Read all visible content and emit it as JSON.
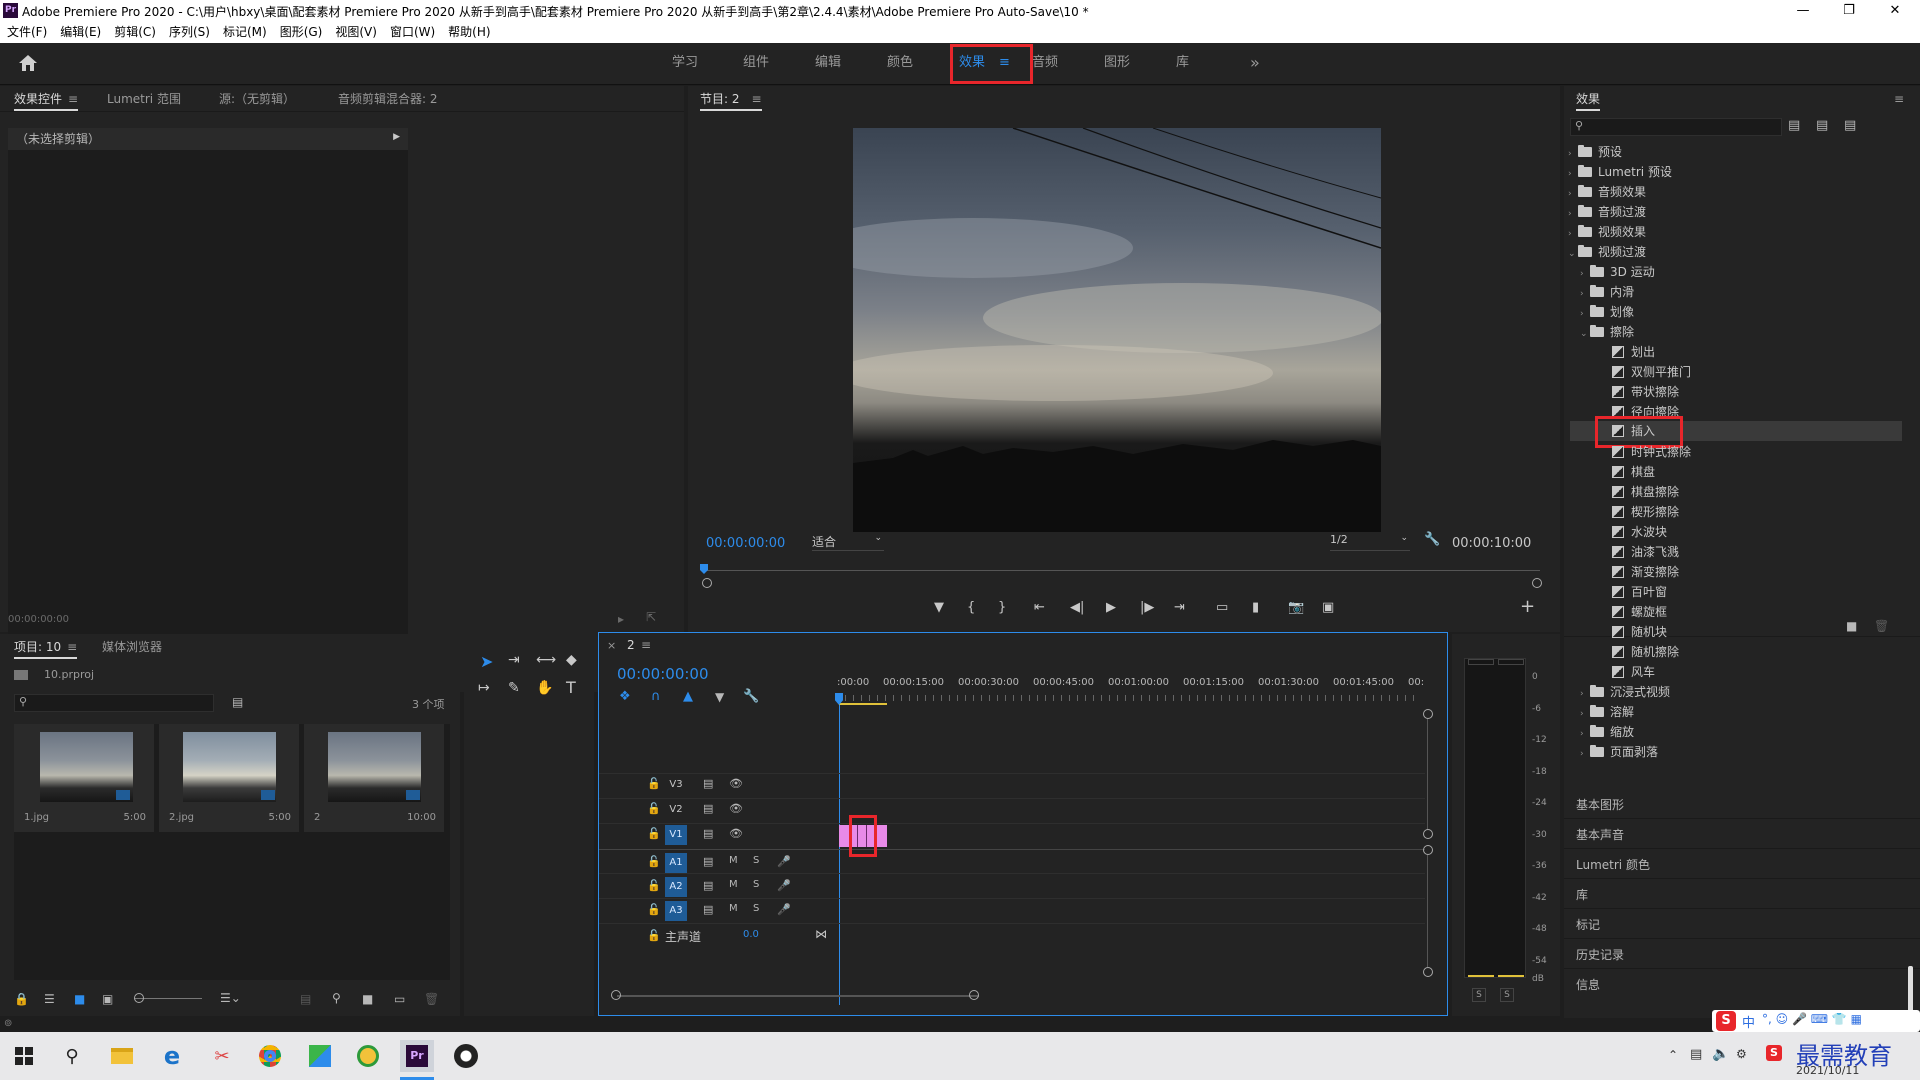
{
  "window": {
    "title": "Adobe Premiere Pro 2020 - C:\\用户\\hbxy\\桌面\\配套素材 Premiere Pro 2020 从新手到高手\\配套素材 Premiere Pro 2020 从新手到高手\\第2章\\2.4.4\\素材\\Adobe Premiere Pro Auto-Save\\10 *",
    "app_icon": "Pr"
  },
  "menu": [
    "文件(F)",
    "编辑(E)",
    "剪辑(C)",
    "序列(S)",
    "标记(M)",
    "图形(G)",
    "视图(V)",
    "窗口(W)",
    "帮助(H)"
  ],
  "workspaces": {
    "tabs": [
      "学习",
      "组件",
      "编辑",
      "颜色",
      "效果",
      "音频",
      "图形",
      "库"
    ],
    "active": "效果",
    "more": "»"
  },
  "effect_controls": {
    "tabs": [
      "效果控件",
      "Lumetri 范围",
      "源:（无剪辑）",
      "音频剪辑混合器: 2"
    ],
    "no_clip": "（未选择剪辑）",
    "timecode": "00:00:00:00"
  },
  "program_monitor": {
    "title": "节目: 2",
    "timecode_current": "00:00:00:00",
    "fit": "适合",
    "quality": "1/2",
    "timecode_duration": "00:00:10:00"
  },
  "project": {
    "tabs": [
      "项目: 10",
      "媒体浏览器"
    ],
    "file": "10.prproj",
    "item_count": "3 个项",
    "items": [
      {
        "name": "1.jpg",
        "duration": "5:00"
      },
      {
        "name": "2.jpg",
        "duration": "5:00"
      },
      {
        "name": "2",
        "duration": "10:00"
      }
    ]
  },
  "timeline": {
    "tab": "2",
    "timecode": "00:00:00:00",
    "ruler": [
      ":00:00",
      "00:00:15:00",
      "00:00:30:00",
      "00:00:45:00",
      "00:01:00:00",
      "00:01:15:00",
      "00:01:30:00",
      "00:01:45:00",
      "00:"
    ],
    "video_tracks": [
      "V3",
      "V2",
      "V1"
    ],
    "audio_tracks": [
      "A1",
      "A2",
      "A3"
    ],
    "master": "主声道",
    "master_value": "0.0",
    "m_label": "M",
    "s_label": "S"
  },
  "meter": {
    "scale": [
      "0",
      "-6",
      "-12",
      "-18",
      "-24",
      "-30",
      "-36",
      "-42",
      "-48",
      "-54",
      "dB"
    ],
    "solo": [
      "S",
      "S"
    ]
  },
  "effects_panel": {
    "title": "效果",
    "tree": [
      {
        "label": "预设",
        "level": 0,
        "kind": "folder",
        "open": false
      },
      {
        "label": "Lumetri 预设",
        "level": 0,
        "kind": "folder",
        "open": false
      },
      {
        "label": "音频效果",
        "level": 0,
        "kind": "folder",
        "open": false
      },
      {
        "label": "音频过渡",
        "level": 0,
        "kind": "folder",
        "open": false
      },
      {
        "label": "视频效果",
        "level": 0,
        "kind": "folder",
        "open": false
      },
      {
        "label": "视频过渡",
        "level": 0,
        "kind": "folder",
        "open": true
      },
      {
        "label": "3D 运动",
        "level": 1,
        "kind": "folder",
        "open": false
      },
      {
        "label": "内滑",
        "level": 1,
        "kind": "folder",
        "open": false
      },
      {
        "label": "划像",
        "level": 1,
        "kind": "folder",
        "open": false
      },
      {
        "label": "擦除",
        "level": 1,
        "kind": "folder",
        "open": true
      },
      {
        "label": "划出",
        "level": 2,
        "kind": "fx"
      },
      {
        "label": "双侧平推门",
        "level": 2,
        "kind": "fx"
      },
      {
        "label": "带状擦除",
        "level": 2,
        "kind": "fx"
      },
      {
        "label": "径向擦除",
        "level": 2,
        "kind": "fx"
      },
      {
        "label": "插入",
        "level": 2,
        "kind": "fx",
        "selected": true
      },
      {
        "label": "时钟式擦除",
        "level": 2,
        "kind": "fx"
      },
      {
        "label": "棋盘",
        "level": 2,
        "kind": "fx"
      },
      {
        "label": "棋盘擦除",
        "level": 2,
        "kind": "fx"
      },
      {
        "label": "楔形擦除",
        "level": 2,
        "kind": "fx"
      },
      {
        "label": "水波块",
        "level": 2,
        "kind": "fx"
      },
      {
        "label": "油漆飞溅",
        "level": 2,
        "kind": "fx"
      },
      {
        "label": "渐变擦除",
        "level": 2,
        "kind": "fx"
      },
      {
        "label": "百叶窗",
        "level": 2,
        "kind": "fx"
      },
      {
        "label": "螺旋框",
        "level": 2,
        "kind": "fx"
      },
      {
        "label": "随机块",
        "level": 2,
        "kind": "fx"
      },
      {
        "label": "随机擦除",
        "level": 2,
        "kind": "fx"
      },
      {
        "label": "风车",
        "level": 2,
        "kind": "fx"
      },
      {
        "label": "沉浸式视频",
        "level": 1,
        "kind": "folder",
        "open": false
      },
      {
        "label": "溶解",
        "level": 1,
        "kind": "folder",
        "open": false
      },
      {
        "label": "缩放",
        "level": 1,
        "kind": "folder",
        "open": false
      },
      {
        "label": "页面剥落",
        "level": 1,
        "kind": "folder",
        "open": false
      }
    ],
    "sections": [
      "基本图形",
      "基本声音",
      "Lumetri 颜色",
      "库",
      "标记",
      "历史记录",
      "信息"
    ]
  },
  "taskbar": {
    "date": "2021/10/11",
    "ime": "中",
    "watermark": "最需教育"
  }
}
